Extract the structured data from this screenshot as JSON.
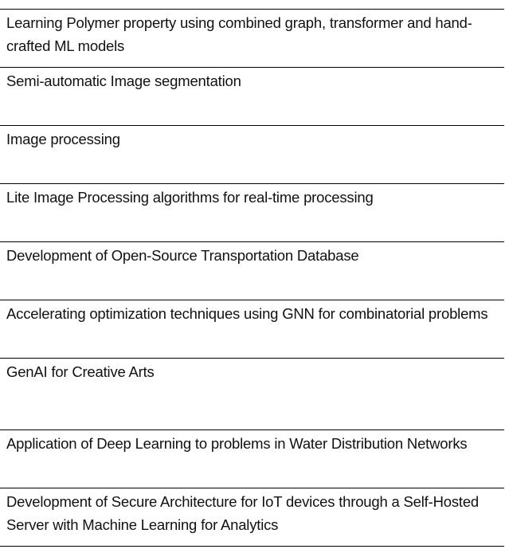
{
  "rows": [
    "Learning Polymer property using combined graph, transformer and hand-crafted ML models",
    "Semi-automatic Image segmentation",
    "Image processing",
    "Lite Image Processing algorithms for real-time processing",
    "Development of Open-Source Transportation Database",
    "Accelerating optimization techniques using GNN for combinatorial problems",
    "GenAI for Creative Arts",
    "Application of Deep Learning to problems in Water Distribution Networks",
    "Development of Secure Architecture for IoT devices through a Self-Hosted Server with Machine Learning for Analytics"
  ]
}
